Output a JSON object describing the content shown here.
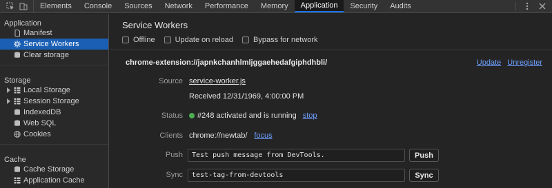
{
  "toolbar": {
    "tabs": [
      {
        "label": "Elements"
      },
      {
        "label": "Console"
      },
      {
        "label": "Sources"
      },
      {
        "label": "Network"
      },
      {
        "label": "Performance"
      },
      {
        "label": "Memory"
      },
      {
        "label": "Application"
      },
      {
        "label": "Security"
      },
      {
        "label": "Audits"
      }
    ],
    "active_tab": "Application"
  },
  "sidebar": {
    "application_title": "Application",
    "application_items": [
      {
        "label": "Manifest",
        "icon": "document-icon"
      },
      {
        "label": "Service Workers",
        "icon": "gear-icon",
        "selected": true
      },
      {
        "label": "Clear storage",
        "icon": "database-icon"
      }
    ],
    "storage_title": "Storage",
    "storage_items": [
      {
        "label": "Local Storage",
        "icon": "grid-icon",
        "expandable": true
      },
      {
        "label": "Session Storage",
        "icon": "grid-icon",
        "expandable": true
      },
      {
        "label": "IndexedDB",
        "icon": "database-icon"
      },
      {
        "label": "Web SQL",
        "icon": "database-icon"
      },
      {
        "label": "Cookies",
        "icon": "globe-icon"
      }
    ],
    "cache_title": "Cache",
    "cache_items": [
      {
        "label": "Cache Storage",
        "icon": "database-icon"
      },
      {
        "label": "Application Cache",
        "icon": "grid-icon"
      }
    ]
  },
  "main": {
    "title": "Service Workers",
    "options": [
      {
        "label": "Offline",
        "checked": false
      },
      {
        "label": "Update on reload",
        "checked": false
      },
      {
        "label": "Bypass for network",
        "checked": false
      }
    ],
    "scope": "chrome-extension://japnkchanhlmljggaehedafgiphdhbli/",
    "update_link": "Update",
    "unregister_link": "Unregister",
    "source_label": "Source",
    "source_file": "service-worker.js",
    "received": "Received 12/31/1969, 4:00:00 PM",
    "status_label": "Status",
    "status_text": "#248 activated and is running",
    "status_color": "#4caf50",
    "stop_link": "stop",
    "clients_label": "Clients",
    "client_url": "chrome://newtab/",
    "focus_link": "focus",
    "push_label": "Push",
    "push_value": "Test push message from DevTools.",
    "push_button": "Push",
    "sync_label": "Sync",
    "sync_value": "test-tag-from-devtools",
    "sync_button": "Sync"
  },
  "colors": {
    "accent": "#1a73e8",
    "selected_bg": "#1a5fb4",
    "link": "#6ea0ff"
  }
}
